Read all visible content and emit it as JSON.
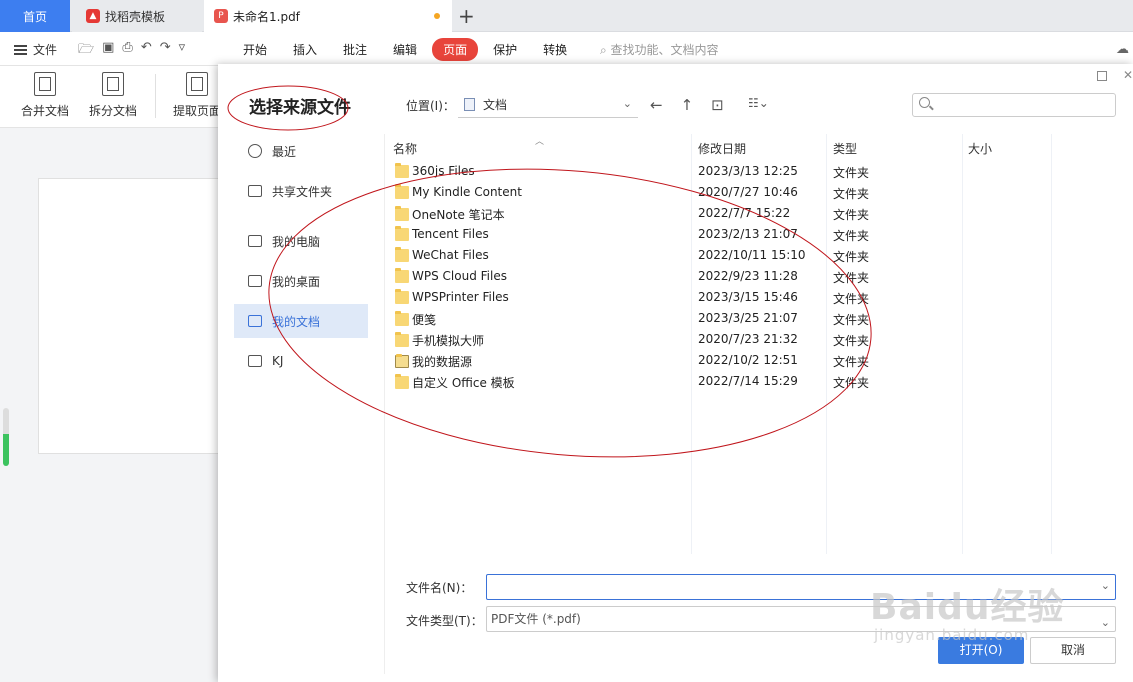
{
  "tabs": {
    "home": "首页",
    "template": "找稻壳模板",
    "document": "未命名1.pdf"
  },
  "menubar": {
    "file": "文件",
    "items": [
      "开始",
      "插入",
      "批注",
      "编辑",
      "页面",
      "保护",
      "转换"
    ],
    "active": "页面",
    "search_placeholder": "查找功能、文档内容"
  },
  "ribbon": {
    "buttons": [
      "合并文档",
      "拆分文档",
      "提取页面"
    ]
  },
  "dialog": {
    "title": "选择来源文件",
    "location_label": "位置(I)：",
    "location_value": "文档",
    "sidebar": [
      "最近",
      "共享文件夹",
      "我的电脑",
      "我的桌面",
      "我的文档",
      "KJ"
    ],
    "sidebar_active": "我的文档",
    "columns": {
      "name": "名称",
      "date": "修改日期",
      "type": "类型",
      "size": "大小"
    },
    "files": [
      {
        "name": "360js Files",
        "date": "2023/3/13 12:25",
        "type": "文件夹"
      },
      {
        "name": "My Kindle Content",
        "date": "2020/7/27 10:46",
        "type": "文件夹"
      },
      {
        "name": "OneNote 笔记本",
        "date": "2022/7/7 15:22",
        "type": "文件夹"
      },
      {
        "name": "Tencent Files",
        "date": "2023/2/13 21:07",
        "type": "文件夹"
      },
      {
        "name": "WeChat Files",
        "date": "2022/10/11 15:10",
        "type": "文件夹"
      },
      {
        "name": "WPS Cloud Files",
        "date": "2022/9/23 11:28",
        "type": "文件夹"
      },
      {
        "name": "WPSPrinter Files",
        "date": "2023/3/15 15:46",
        "type": "文件夹"
      },
      {
        "name": "便笺",
        "date": "2023/3/25 21:07",
        "type": "文件夹"
      },
      {
        "name": "手机模拟大师",
        "date": "2020/7/23 21:32",
        "type": "文件夹"
      },
      {
        "name": "我的数据源",
        "date": "2022/10/2 12:51",
        "type": "文件夹"
      },
      {
        "name": "自定义 Office 模板",
        "date": "2022/7/14 15:29",
        "type": "文件夹"
      }
    ],
    "filename_label": "文件名(N)：",
    "filename_value": "",
    "filetype_label": "文件类型(T)：",
    "filetype_value": "PDF文件 (*.pdf)",
    "open_button": "打开(O)",
    "cancel_button": "取消"
  },
  "watermark": {
    "brand": "Baidu经验",
    "url": "jingyan.baidu.com"
  },
  "colors": {
    "accent": "#3a7be0",
    "active_menu": "#e8443b",
    "annotation": "#c0151b"
  }
}
